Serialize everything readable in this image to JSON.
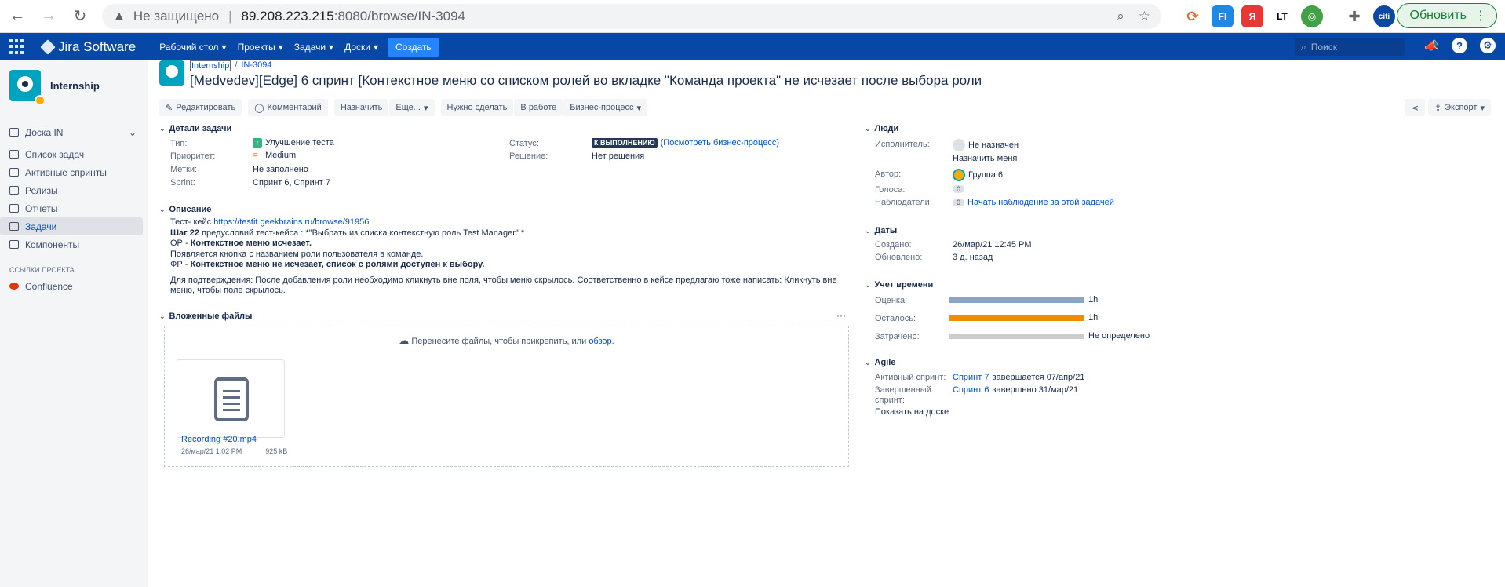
{
  "browser": {
    "insecure_label": "Не защищено",
    "url_host": "89.208.223.215",
    "url_path": ":8080/browse/IN-3094",
    "update_label": "Обновить",
    "ext_citi": "citi",
    "ext_fi": "FI",
    "ext_ya": "Я",
    "ext_lt": "LT"
  },
  "jira": {
    "product_name": "Jira Software",
    "menu": [
      "Рабочий стол",
      "Проекты",
      "Задачи",
      "Доски"
    ],
    "create_label": "Создать",
    "search_placeholder": "Поиск"
  },
  "sidebar": {
    "project_name": "Internship",
    "board_label": "Доска IN",
    "items": [
      "Список задач",
      "Активные спринты",
      "Релизы",
      "Отчеты",
      "Задачи",
      "Компоненты"
    ],
    "links_caption": "ССЫЛКИ ПРОЕКТА",
    "confluence_label": "Confluence"
  },
  "issue": {
    "project_crumb": "Internship",
    "key": "IN-3094",
    "title": "[Medvedev][Edge] 6 спринт [Контекстное меню со списком ролей во вкладке \"Команда проекта\" не исчезает после выбора роли",
    "toolbar": {
      "edit": "Редактировать",
      "comment": "Комментарий",
      "assign": "Назначить",
      "more": "Еще...",
      "todo": "Нужно сделать",
      "in_progress": "В работе",
      "workflow": "Бизнес-процесс",
      "export": "Экспорт"
    },
    "details": {
      "heading": "Детали задачи",
      "type_label": "Тип:",
      "type_value": "Улучшение теста",
      "priority_label": "Приоритет:",
      "priority_value": "Medium",
      "labels_label": "Метки:",
      "labels_value": "Не заполнено",
      "sprint_label": "Sprint:",
      "sprint_value": "Спринт 6, Спринт 7",
      "status_label": "Статус:",
      "status_value": "К ВЫПОЛНЕНИЮ",
      "status_link": "(Посмотреть бизнес-процесс)",
      "resolution_label": "Решение:",
      "resolution_value": "Нет решения"
    },
    "description": {
      "heading": "Описание",
      "line1_prefix": "Тест- кейс ",
      "line1_link": "https://testit.geekbrains.ru/browse/91956",
      "line2_bold": "Шаг 22",
      "line2_rest": " предусловий тест-кейса : *\"Выбрать из списка контекстную роль Test Manager\" *",
      "line3_prefix": "ОР - ",
      "line3_bold": "Контекстное меню исчезает.",
      "line4": "Появляется кнопка с названием роли пользователя в команде.",
      "line5_prefix": "ФР - ",
      "line5_bold": "Контекстное меню не исчезает, список с ролями доступен к выбору.",
      "line6": "Для подтверждения: После добавления роли необходимо кликнуть вне поля, чтобы меню скрылось. Соответственно в кейсе предлагаю тоже написать: Кликнуть вне меню, чтобы поле скрылось."
    },
    "attachments": {
      "heading": "Вложенные файлы",
      "more": "···",
      "drop_text": "Перенесите файлы, чтобы прикрепить, или ",
      "browse_link": "обзор",
      "file_name": "Recording #20.mp4",
      "file_date": "26/мар/21 1:02 PM",
      "file_size": "925 kB"
    }
  },
  "people": {
    "heading": "Люди",
    "assignee_label": "Исполнитель:",
    "assignee_value": "Не назначен",
    "assign_me": "Назначить меня",
    "reporter_label": "Автор:",
    "reporter_value": "Группа 6",
    "votes_label": "Голоса:",
    "votes_value": "0",
    "watchers_label": "Наблюдатели:",
    "watchers_value": "0",
    "watch_link": "Начать наблюдение за этой задачей"
  },
  "dates": {
    "heading": "Даты",
    "created_label": "Создано:",
    "created_value": "26/мар/21 12:45 PM",
    "updated_label": "Обновлено:",
    "updated_value": "3 д. назад"
  },
  "time_tracking": {
    "heading": "Учет времени",
    "plus": "+",
    "estimate_label": "Оценка:",
    "estimate_value": "1h",
    "estimate_fill": 1.0,
    "remaining_label": "Осталось:",
    "remaining_value": "1h",
    "remaining_fill": 1.0,
    "logged_label": "Затрачено:",
    "logged_value": "Не определено",
    "logged_fill": 0.0,
    "colors": {
      "estimate": "#89a4c7",
      "remaining": "#ec8e00",
      "logged": "#cccccc"
    }
  },
  "agile": {
    "heading": "Agile",
    "active_label": "Активный спринт:",
    "active_link": "Спринт 7",
    "active_rest": "завершается 07/апр/21",
    "completed_label_1": "Завершенный",
    "completed_label_2": "спринт:",
    "completed_link": "Спринт 6",
    "completed_rest": "завершено 31/мар/21",
    "board_link": "Показать на доске"
  }
}
